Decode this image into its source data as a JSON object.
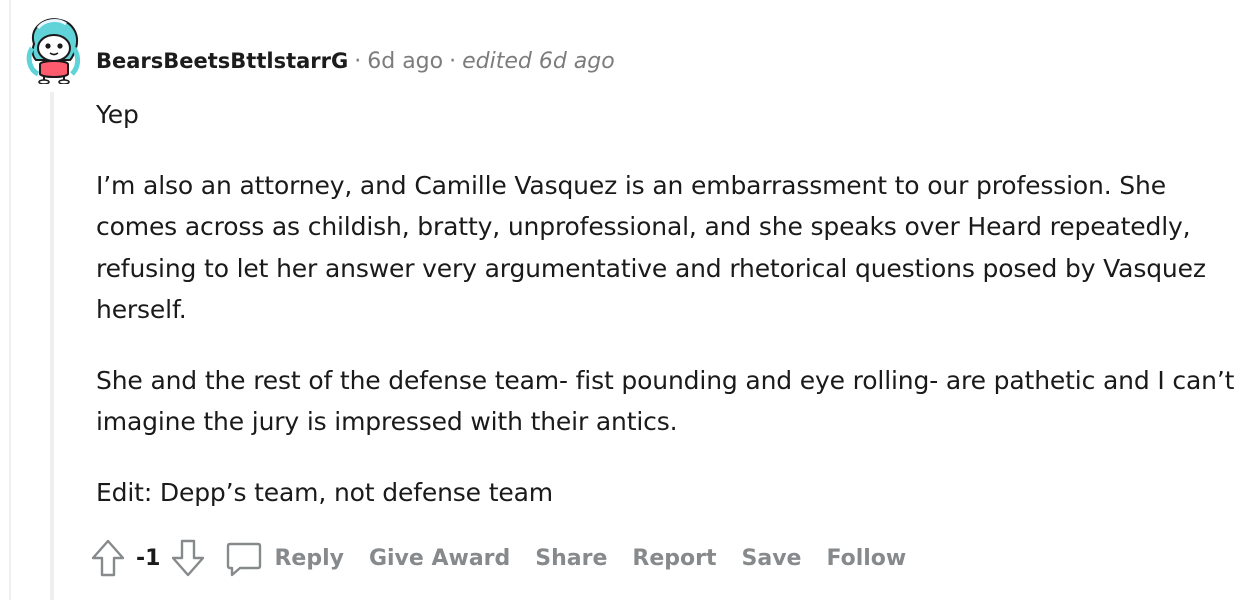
{
  "comment": {
    "username": "BearsBeetsBttlstarrG",
    "separator": "·",
    "time_ago": "6d ago",
    "edited": "edited 6d ago",
    "paragraphs": [
      "Yep",
      "I’m also an attorney, and Camille Vasquez is an embarrassment to our profession. She comes across as childish, bratty, unprofessional, and she speaks over Heard repeatedly, refusing to let her answer very argumentative and rhetorical questions posed by Vasquez herself.",
      "She and the rest of the defense team- fist pounding and eye rolling- are pathetic and I can’t imagine the jury is impressed with their antics.",
      "Edit: Depp’s team, not defense team"
    ],
    "score": "-1"
  },
  "actions": {
    "reply": "Reply",
    "give_award": "Give Award",
    "share": "Share",
    "report": "Report",
    "save": "Save",
    "follow": "Follow"
  },
  "icons": {
    "upvote": "upvote-arrow-icon",
    "downvote": "downvote-arrow-icon",
    "comment": "comment-bubble-icon",
    "avatar": "snoo-avatar"
  },
  "colors": {
    "meta_gray": "#7c7c7c",
    "action_gray": "#878a8c",
    "thread_line": "#edeff1",
    "text": "#1a1a1b"
  }
}
